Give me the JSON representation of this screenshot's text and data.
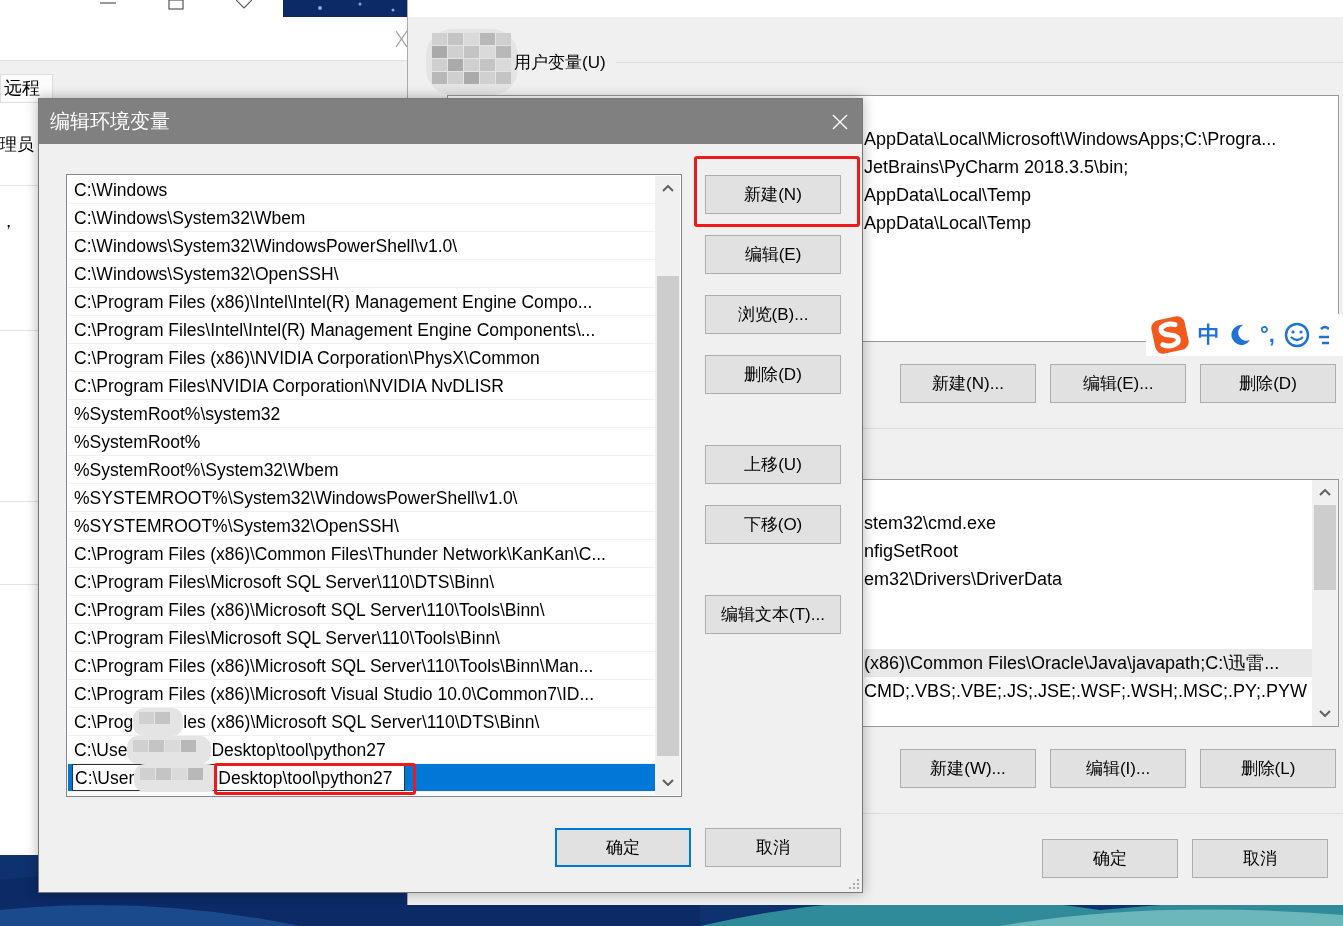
{
  "back_window": {
    "tab": {
      "label": "远程",
      "selected": true
    },
    "texts": [
      "理员",
      "，"
    ]
  },
  "env_window": {
    "user_vars": {
      "label": "用户变量(U)",
      "redacted": true,
      "rows": [
        {
          "text": "AppData\\Local\\Microsoft\\WindowsApps;C:\\Progra...",
          "selected": false
        },
        {
          "text": "JetBrains\\PyCharm 2018.3.5\\bin;",
          "selected": false
        },
        {
          "text": "AppData\\Local\\Temp",
          "selected": false
        },
        {
          "text": "AppData\\Local\\Temp",
          "selected": false
        }
      ],
      "buttons": [
        "新建(N)...",
        "编辑(E)...",
        "删除(D)"
      ]
    },
    "ime_toolbar": {
      "mode": "中",
      "punctuation": "°,"
    },
    "system_vars": {
      "rows": [
        {
          "text": "stem32\\cmd.exe",
          "selected": false
        },
        {
          "text": "nfigSetRoot",
          "selected": false
        },
        {
          "text": "em32\\Drivers\\DriverData",
          "selected": false
        },
        {
          "text": "(x86)\\Common Files\\Oracle\\Java\\javapath;C:\\迅雷...",
          "selected": true
        },
        {
          "text": "CMD;.VBS;.VBE;.JS;.JSE;.WSF;.WSH;.MSC;.PY;.PYW",
          "selected": false
        }
      ],
      "buttons": [
        "新建(W)...",
        "编辑(I)...",
        "删除(L)"
      ]
    },
    "buttons": [
      "确定",
      "取消"
    ]
  },
  "dialog": {
    "title": "编辑环境变量",
    "rows": [
      {
        "text": "C:\\Windows",
        "selected": false
      },
      {
        "text": "C:\\Windows\\System32\\Wbem",
        "selected": false
      },
      {
        "text": "C:\\Windows\\System32\\WindowsPowerShell\\v1.0\\",
        "selected": false
      },
      {
        "text": "C:\\Windows\\System32\\OpenSSH\\",
        "selected": false
      },
      {
        "text": "C:\\Program Files (x86)\\Intel\\Intel(R) Management Engine Compo...",
        "selected": false
      },
      {
        "text": "C:\\Program Files\\Intel\\Intel(R) Management Engine Components\\...",
        "selected": false
      },
      {
        "text": "C:\\Program Files (x86)\\NVIDIA Corporation\\PhysX\\Common",
        "selected": false
      },
      {
        "text": "C:\\Program Files\\NVIDIA Corporation\\NVIDIA NvDLISR",
        "selected": false
      },
      {
        "text": "%SystemRoot%\\system32",
        "selected": false
      },
      {
        "text": "%SystemRoot%",
        "selected": false
      },
      {
        "text": "%SystemRoot%\\System32\\Wbem",
        "selected": false
      },
      {
        "text": "%SYSTEMROOT%\\System32\\WindowsPowerShell\\v1.0\\",
        "selected": false
      },
      {
        "text": "%SYSTEMROOT%\\System32\\OpenSSH\\",
        "selected": false
      },
      {
        "text": "C:\\Program Files (x86)\\Common Files\\Thunder Network\\KanKan\\C...",
        "selected": false
      },
      {
        "text": "C:\\Program Files\\Microsoft SQL Server\\110\\DTS\\Binn\\",
        "selected": false
      },
      {
        "text": "C:\\Program Files (x86)\\Microsoft SQL Server\\110\\Tools\\Binn\\",
        "selected": false
      },
      {
        "text": "C:\\Program Files\\Microsoft SQL Server\\110\\Tools\\Binn\\",
        "selected": false
      },
      {
        "text": "C:\\Program Files (x86)\\Microsoft SQL Server\\110\\Tools\\Binn\\Man...",
        "selected": false
      },
      {
        "text": "C:\\Program Files (x86)\\Microsoft Visual Studio 10.0\\Common7\\ID...",
        "selected": false
      },
      {
        "parts": [
          "C:\\Prog",
          "les (x86)\\Microsoft SQL Server\\110\\DTS\\Binn\\"
        ],
        "selected": false
      },
      {
        "parts": [
          "C:\\Use",
          "Desktop\\tool\\python27"
        ],
        "selected": false
      },
      {
        "parts": [
          "C:\\User",
          "Desktop\\tool\\python27"
        ],
        "selected": true,
        "editing": true,
        "highlighted": true
      }
    ],
    "side_buttons": [
      {
        "label": "新建(N)",
        "highlighted": true
      },
      {
        "label": "编辑(E)",
        "highlighted": false
      },
      {
        "label": "浏览(B)...",
        "highlighted": false
      },
      {
        "label": "删除(D)",
        "highlighted": false
      },
      {
        "label": "上移(U)",
        "highlighted": false
      },
      {
        "label": "下移(O)",
        "highlighted": false
      },
      {
        "label": "编辑文本(T)...",
        "highlighted": false
      }
    ],
    "buttons": [
      {
        "label": "确定",
        "default": true
      },
      {
        "label": "取消",
        "default": false
      }
    ]
  }
}
